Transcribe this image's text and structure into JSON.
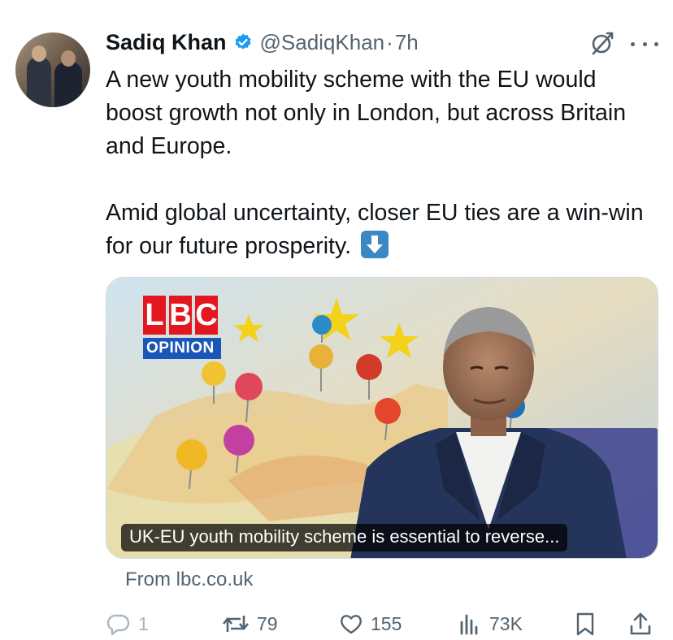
{
  "author": {
    "name": "Sadiq Khan",
    "handle": "@SadiqKhan",
    "separator": "·",
    "time": "7h",
    "verified_color": "#1d9bf0"
  },
  "tweet": {
    "paragraph1": "A new youth mobility scheme with the EU would boost growth not only in London, but across Britain and Europe.",
    "paragraph2": "Amid global uncertainty, closer EU ties are a win-win for our future prosperity.",
    "emoji": "down-arrow-emoji"
  },
  "card": {
    "logo_letters": [
      "L",
      "B",
      "C"
    ],
    "logo_subtitle": "OPINION",
    "caption": "UK-EU youth mobility scheme is essential to reverse...",
    "source": "From lbc.co.uk"
  },
  "actions": {
    "replies": "1",
    "reposts": "79",
    "likes": "155",
    "views": "73K"
  },
  "icons": {
    "grok": "grok-icon",
    "more": "more-icon",
    "reply": "reply-icon",
    "repost": "repost-icon",
    "like": "heart-icon",
    "views": "views-icon",
    "bookmark": "bookmark-icon",
    "share": "share-icon"
  },
  "colors": {
    "text": "#0f1419",
    "secondary": "#536471",
    "accent": "#1d9bf0",
    "lbc_red": "#e3171f",
    "lbc_blue": "#1a56b8"
  }
}
